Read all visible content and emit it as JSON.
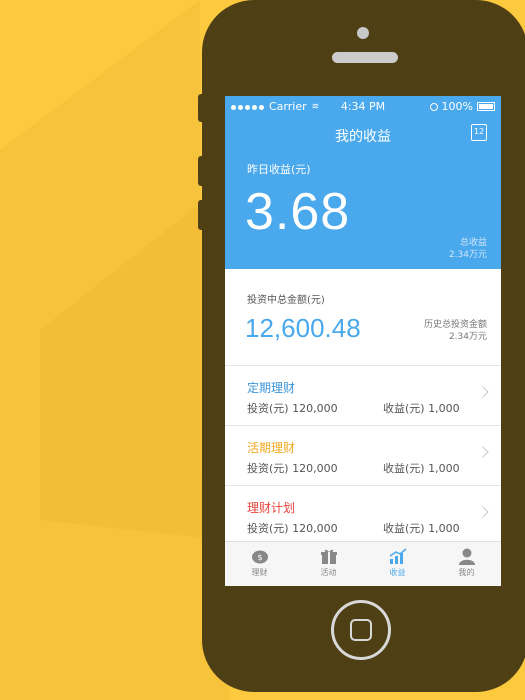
{
  "status_bar": {
    "carrier": "Carrier",
    "time": "4:34 PM",
    "battery": "100%"
  },
  "nav": {
    "title": "我的收益",
    "calendar_label": "12"
  },
  "hero": {
    "label": "昨日收益(元)",
    "value": "3.68",
    "total_label": "总收益",
    "total_value": "2.34万元"
  },
  "investment": {
    "label": "投资中总金额(元)",
    "value": "12,600.48",
    "history_label": "历史总投资金额",
    "history_value": "2.34万元"
  },
  "products": [
    {
      "name": "定期理财",
      "color": "#3a96db",
      "invest": "投资(元) 120,000",
      "income": "收益(元) 1,000"
    },
    {
      "name": "活期理财",
      "color": "#f2a81d",
      "invest": "投资(元) 120,000",
      "income": "收益(元) 1,000"
    },
    {
      "name": "理财计划",
      "color": "#e8453c",
      "invest": "投资(元) 120,000",
      "income": "收益(元) 1,000"
    }
  ],
  "tabs": [
    {
      "label": "理财",
      "icon": "piggy-bank-icon",
      "active": false
    },
    {
      "label": "活动",
      "icon": "gift-icon",
      "active": false
    },
    {
      "label": "收益",
      "icon": "chart-icon",
      "active": true
    },
    {
      "label": "我的",
      "icon": "user-icon",
      "active": false
    }
  ],
  "colors": {
    "background": "#fcc93f",
    "phone": "#4e3f14",
    "accent": "#4aa8ec"
  }
}
